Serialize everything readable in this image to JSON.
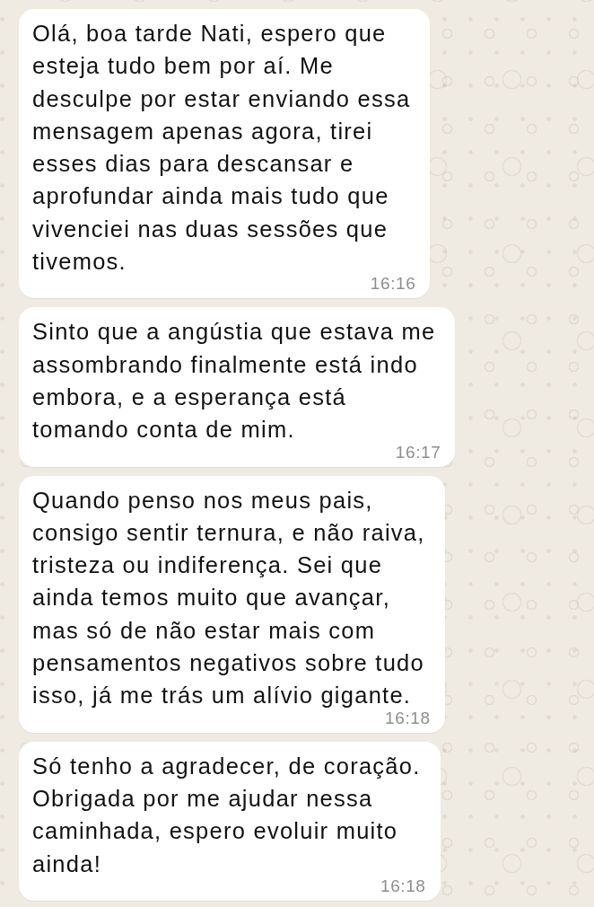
{
  "messages": [
    {
      "text": "Olá, boa tarde Nati, espero que\nesteja tudo bem por aí. Me\ndesculpe por estar enviando essa\nmensagem apenas agora, tirei\nesses dias para descansar e\naprofundar ainda mais tudo que\nvivenciei nas duas sessões que\ntivemos.",
      "time": "16:16"
    },
    {
      "text": "Sinto que a angústia que estava me\nassombrando finalmente está indo\nembora, e a esperança está\ntomando conta de mim.",
      "time": "16:17"
    },
    {
      "text": "Quando penso nos meus pais,\nconsigo sentir ternura, e não raiva,\ntristeza ou indiferença. Sei que\nainda temos muito que avançar,\nmas só de não estar mais com\npensamentos negativos sobre tudo\nisso, já me trás um alívio gigante.",
      "time": "16:18"
    },
    {
      "text": "Só tenho a agradecer, de coração.\nObrigada por me ajudar nessa\ncaminhada, espero evoluir muito\nainda!",
      "time": "16:18"
    }
  ]
}
